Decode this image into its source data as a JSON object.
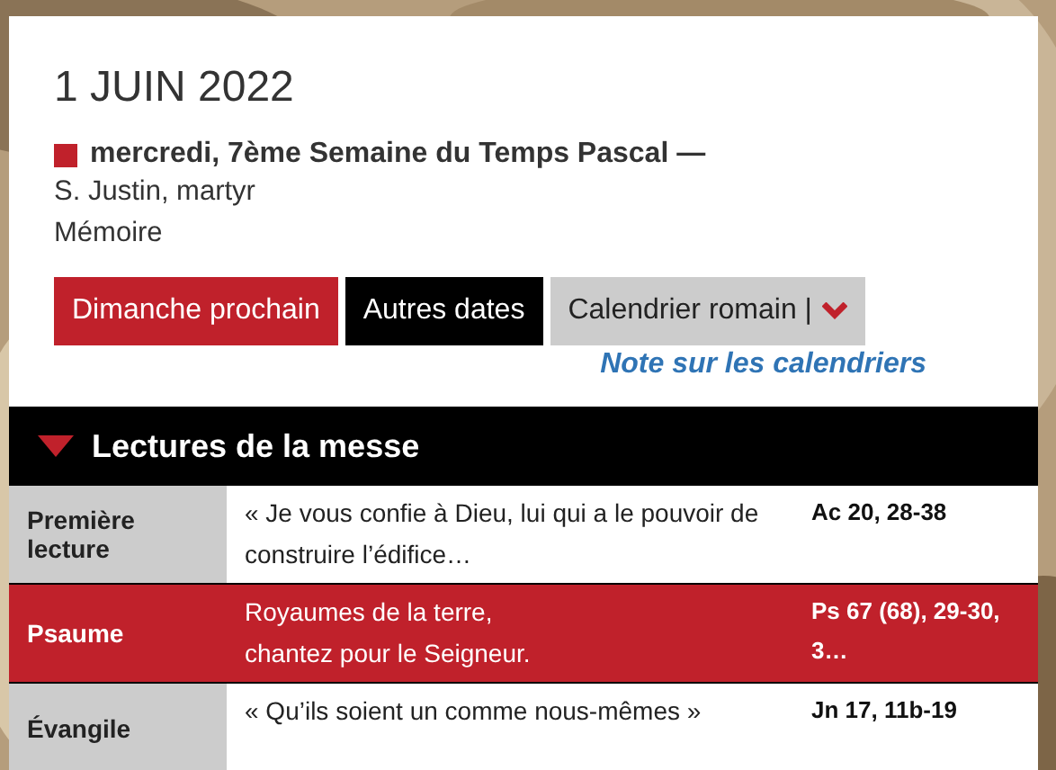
{
  "date": "1 JUIN 2022",
  "day": {
    "title": "mercredi, 7ème Semaine du Temps Pascal —",
    "color": "#c0212b",
    "saint": "S. Justin, martyr",
    "rank": "Mémoire"
  },
  "buttons": [
    {
      "label": "Dimanche prochain",
      "kind": "primary"
    },
    {
      "label": "Autres dates",
      "kind": "dark"
    },
    {
      "label": "Calendrier romain |",
      "kind": "dropdown"
    }
  ],
  "note_link": "Note sur les calendriers",
  "section": {
    "title": "Lectures de la messe",
    "expanded": true
  },
  "readings": [
    {
      "label": "Première lecture",
      "text": "« Je vous confie à Dieu, lui qui a le pouvoir de construire l’édifice…",
      "ref": "Ac 20, 28-38",
      "selected": false
    },
    {
      "label": "Psaume",
      "text": "Royaumes de la terre,\nchantez pour le Seigneur.",
      "ref": "Ps 67 (68), 29-30, 3…",
      "selected": true
    },
    {
      "label": "Évangile",
      "text": "« Qu’ils soient un comme nous-mêmes »",
      "ref": "Jn 17, 11b-19",
      "selected": false
    }
  ]
}
